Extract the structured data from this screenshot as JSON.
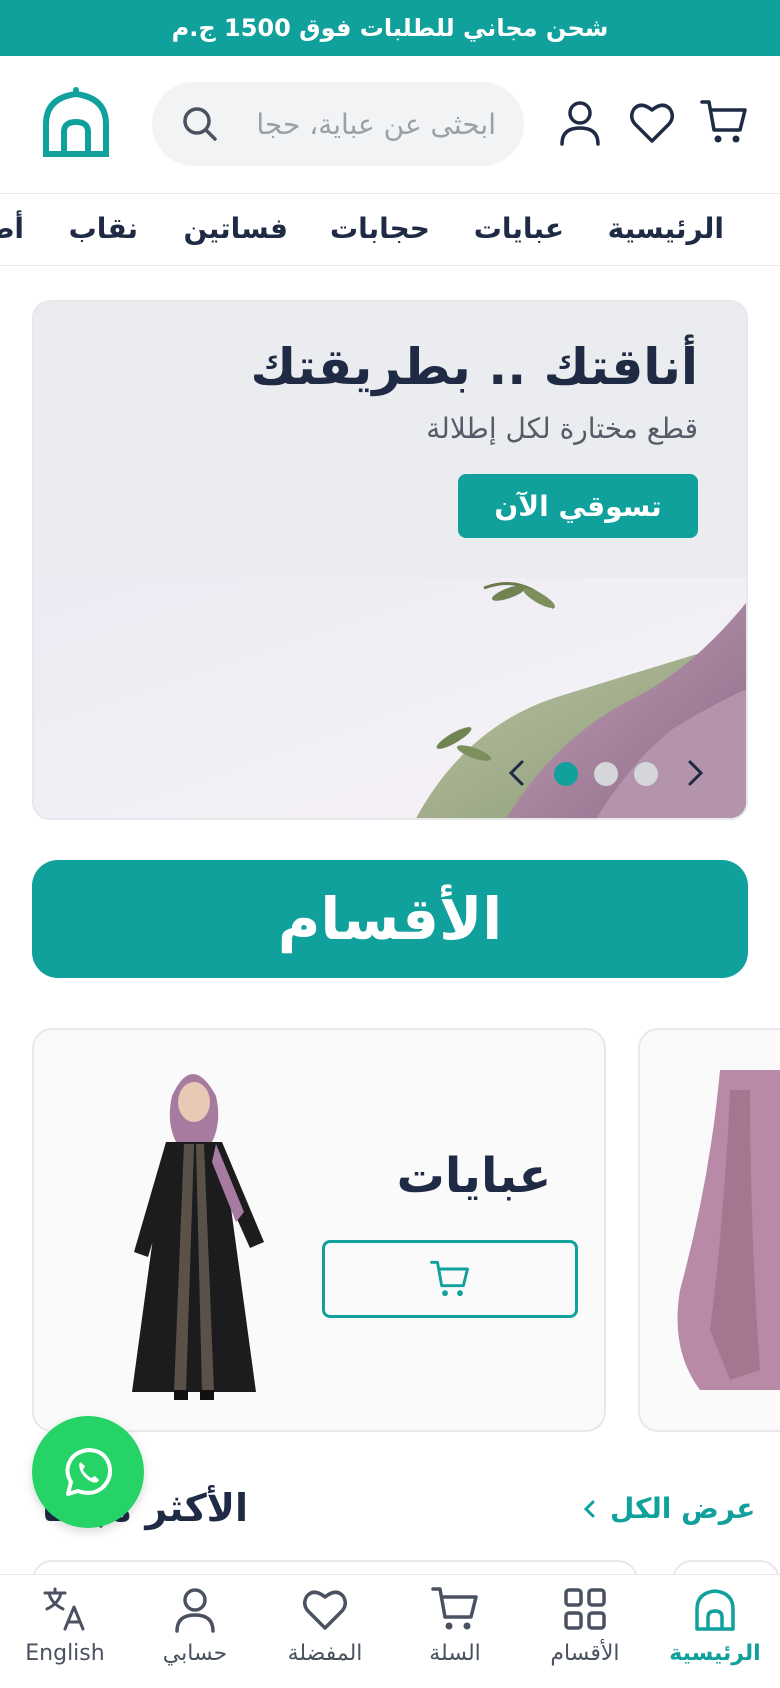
{
  "promo": {
    "text": "شحن مجاني للطلبات فوق 1500 ج.م"
  },
  "header": {
    "search_placeholder": "ابحثى عن عباية، حجا",
    "icons": [
      "cart-icon",
      "heart-icon",
      "user-icon",
      "search-icon",
      "logo-icon"
    ]
  },
  "nav": {
    "items": [
      "الرئيسية",
      "عبايات",
      "حجابات",
      "فساتين",
      "نقاب",
      "أط"
    ]
  },
  "hero": {
    "title": "أناقتك .. بطريقتك",
    "subtitle": "قطع مختارة لكل إطلالة",
    "cta": "تسوقي الآن",
    "active_slide": 1,
    "slide_count": 3
  },
  "sections": {
    "title": "الأقسام",
    "cards": [
      {
        "name": "عبايات"
      }
    ]
  },
  "most": {
    "title": "الأكثر مبيعا",
    "view_all": "عرض الكل"
  },
  "bottom_nav": {
    "items": [
      {
        "label": "الرئيسية",
        "icon": "home-icon",
        "active": true
      },
      {
        "label": "الأقسام",
        "icon": "grid-icon",
        "active": false
      },
      {
        "label": "السلة",
        "icon": "cart-icon",
        "active": false
      },
      {
        "label": "المفضلة",
        "icon": "heart-icon",
        "active": false
      },
      {
        "label": "حسابي",
        "icon": "user-icon",
        "active": false
      },
      {
        "label": "English",
        "icon": "translate-icon",
        "active": false
      }
    ]
  },
  "colors": {
    "accent": "#10a19d",
    "text": "#1f2a44",
    "whatsapp": "#25d366"
  }
}
